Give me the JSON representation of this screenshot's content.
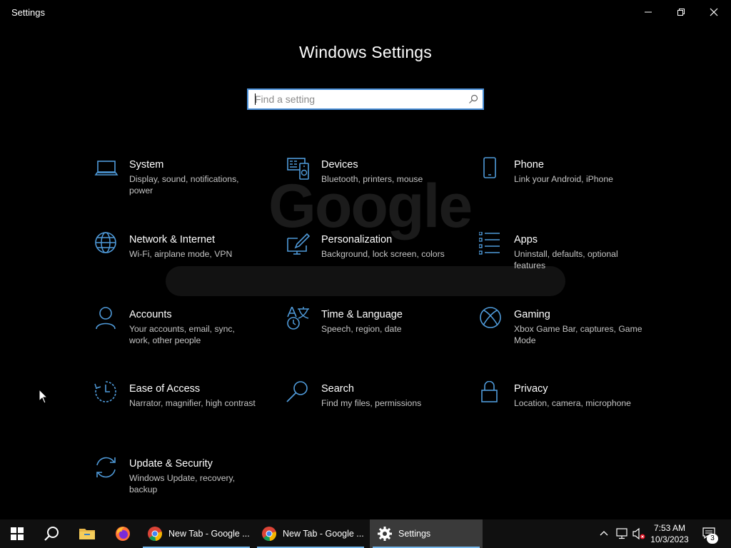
{
  "window": {
    "title": "Settings",
    "heading": "Windows Settings"
  },
  "search": {
    "placeholder": "Find a setting",
    "value": ""
  },
  "categories": [
    {
      "name": "System",
      "desc": "Display, sound, notifications, power",
      "icon": "laptop-icon"
    },
    {
      "name": "Devices",
      "desc": "Bluetooth, printers, mouse",
      "icon": "devices-icon"
    },
    {
      "name": "Phone",
      "desc": "Link your Android, iPhone",
      "icon": "phone-icon"
    },
    {
      "name": "Network & Internet",
      "desc": "Wi-Fi, airplane mode, VPN",
      "icon": "globe-icon"
    },
    {
      "name": "Personalization",
      "desc": "Background, lock screen, colors",
      "icon": "paint-icon"
    },
    {
      "name": "Apps",
      "desc": "Uninstall, defaults, optional features",
      "icon": "apps-list-icon"
    },
    {
      "name": "Accounts",
      "desc": "Your accounts, email, sync, work, other people",
      "icon": "person-icon"
    },
    {
      "name": "Time & Language",
      "desc": "Speech, region, date",
      "icon": "time-language-icon"
    },
    {
      "name": "Gaming",
      "desc": "Xbox Game Bar, captures, Game Mode",
      "icon": "xbox-icon"
    },
    {
      "name": "Ease of Access",
      "desc": "Narrator, magnifier, high contrast",
      "icon": "ease-of-access-icon"
    },
    {
      "name": "Search",
      "desc": "Find my files, permissions",
      "icon": "search-icon"
    },
    {
      "name": "Privacy",
      "desc": "Location, camera, microphone",
      "icon": "lock-icon"
    },
    {
      "name": "Update & Security",
      "desc": "Windows Update, recovery, backup",
      "icon": "sync-icon"
    }
  ],
  "taskbar": {
    "apps": [
      {
        "label": "New Tab - Google ...",
        "icon": "chrome-icon"
      },
      {
        "label": "New Tab - Google ...",
        "icon": "chrome-icon"
      },
      {
        "label": "Settings",
        "icon": "gear-icon"
      }
    ],
    "time": "7:53 AM",
    "date": "10/3/2023",
    "notification_count": "3"
  },
  "colors": {
    "accent": "#4f9ad9",
    "background": "#000000",
    "taskbar": "#101010",
    "active_app": "#3a3a3a"
  }
}
